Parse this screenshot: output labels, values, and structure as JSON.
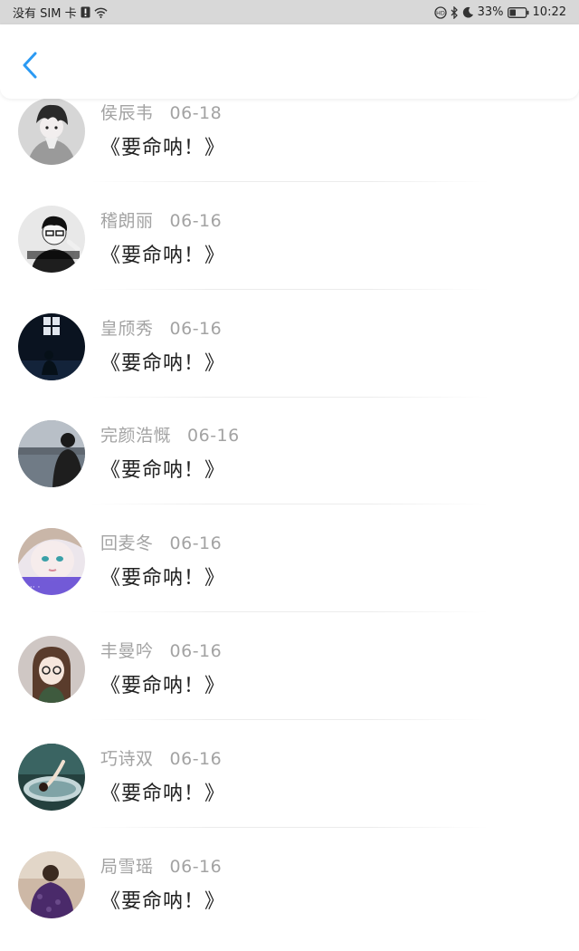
{
  "status_bar": {
    "carrier": "没有 SIM 卡",
    "battery": "33%",
    "time": "10:22"
  },
  "colors": {
    "accent": "#2b9af3",
    "meta_text": "#a3a3a3",
    "content_text": "#222222"
  },
  "items": [
    {
      "name": "侯辰韦",
      "date": "06-18",
      "content": "《要命呐！》",
      "avatar": "anime-boy"
    },
    {
      "name": "稽朗丽",
      "date": "06-16",
      "content": "《要命呐！》",
      "avatar": "bw-boy"
    },
    {
      "name": "皇颀秀",
      "date": "06-16",
      "content": "《要命呐！》",
      "avatar": "dark-room"
    },
    {
      "name": "完颜浩慨",
      "date": "06-16",
      "content": "《要命呐！》",
      "avatar": "seaside"
    },
    {
      "name": "回麦冬",
      "date": "06-16",
      "content": "《要命呐！》",
      "avatar": "girl-face"
    },
    {
      "name": "丰曼吟",
      "date": "06-16",
      "content": "《要命呐！》",
      "avatar": "girl-glasses"
    },
    {
      "name": "巧诗双",
      "date": "06-16",
      "content": "《要命呐！》",
      "avatar": "bath"
    },
    {
      "name": "局雪瑶",
      "date": "06-16",
      "content": "《要命呐！》",
      "avatar": "purple-dress"
    }
  ]
}
